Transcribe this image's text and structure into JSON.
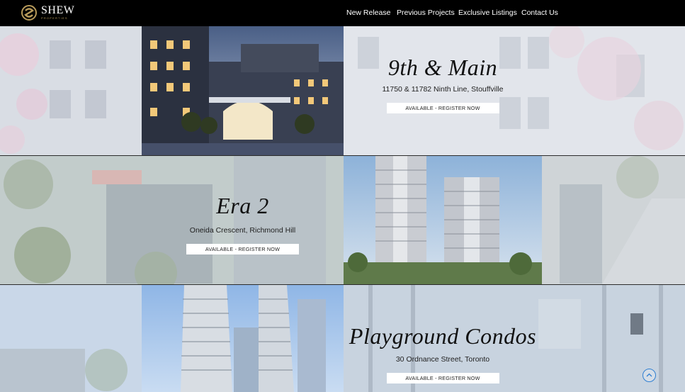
{
  "header": {
    "logo_text": "SHEW",
    "logo_sub": "PROPERTIES",
    "nav": [
      "New Release",
      "Previous Projects",
      "Exclusive Listings",
      "Contact Us"
    ]
  },
  "projects": [
    {
      "title": "9th & Main",
      "address": "11750 & 11782 Ninth Line, Stouffville",
      "cta": "AVAILABLE - REGISTER NOW"
    },
    {
      "title": "Era 2",
      "address": "Oneida Crescent, Richmond Hill",
      "cta": "AVAILABLE - REGISTER NOW"
    },
    {
      "title": "Playground Condos",
      "address": "30 Ordnance Street, Toronto",
      "cta": "AVAILABLE - REGISTER NOW"
    }
  ],
  "icons": {
    "scroll_top": "chevron-up-icon"
  },
  "colors": {
    "header_bg": "#000000",
    "logo_gold": "#b79a5a",
    "scroll_top_accent": "#2f7fd2"
  }
}
